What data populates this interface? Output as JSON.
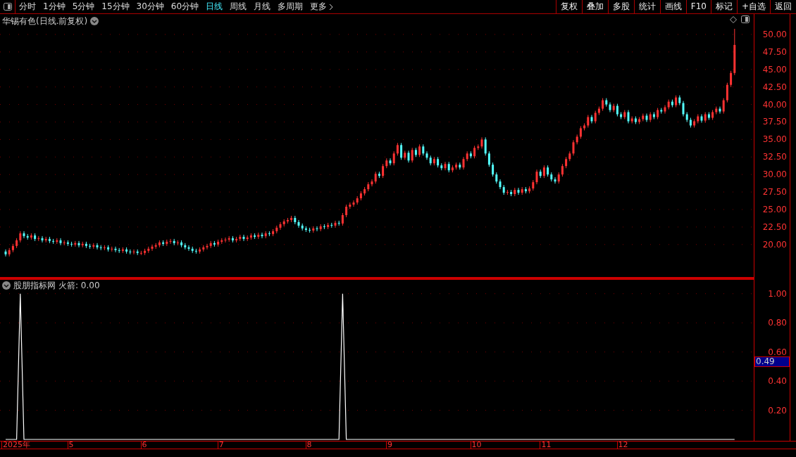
{
  "toolbar": {
    "periods": [
      {
        "label": "分时",
        "selected": false
      },
      {
        "label": "1分钟",
        "selected": false
      },
      {
        "label": "5分钟",
        "selected": false
      },
      {
        "label": "15分钟",
        "selected": false
      },
      {
        "label": "30分钟",
        "selected": false
      },
      {
        "label": "60分钟",
        "selected": false
      },
      {
        "label": "日线",
        "selected": true
      },
      {
        "label": "周线",
        "selected": false
      },
      {
        "label": "月线",
        "selected": false
      },
      {
        "label": "多周期",
        "selected": false
      }
    ],
    "more": "更多",
    "actions": [
      "复权",
      "叠加",
      "多股",
      "统计",
      "画线",
      "F10",
      "标记",
      "+自选",
      "返回"
    ]
  },
  "main_chart": {
    "title": "华锡有色(日线.前复权)",
    "chart_data": {
      "type": "candlestick",
      "ylim": [
        15.16,
        52.91
      ],
      "grid": true,
      "yticks": [
        {
          "value": 50,
          "label": "50.00"
        },
        {
          "value": 47.5,
          "label": "47.50"
        },
        {
          "value": 45,
          "label": "45.00"
        },
        {
          "value": 42.5,
          "label": "42.50"
        },
        {
          "value": 40,
          "label": "40.00"
        },
        {
          "value": 37.5,
          "label": "37.50"
        },
        {
          "value": 35,
          "label": "35.00"
        },
        {
          "value": 32.5,
          "label": "32.50"
        },
        {
          "value": 30,
          "label": "30.00"
        },
        {
          "value": 27.5,
          "label": "27.50"
        },
        {
          "value": 25,
          "label": "25.00"
        },
        {
          "value": 22.5,
          "label": "22.50"
        },
        {
          "value": 20,
          "label": "20.00"
        }
      ],
      "ohlc": [
        [
          19.0,
          19.3,
          18.3,
          18.6
        ],
        [
          18.6,
          19.5,
          18.3,
          19.2
        ],
        [
          19.2,
          20.1,
          18.9,
          19.8
        ],
        [
          19.8,
          20.9,
          19.5,
          20.6
        ],
        [
          20.6,
          21.9,
          20.3,
          21.6
        ],
        [
          21.6,
          21.9,
          20.9,
          21.2
        ],
        [
          21.2,
          21.5,
          20.7,
          21.0
        ],
        [
          21.0,
          21.6,
          20.7,
          21.3
        ],
        [
          21.3,
          21.6,
          20.5,
          20.8
        ],
        [
          20.8,
          21.2,
          20.5,
          20.9
        ],
        [
          20.9,
          21.2,
          20.3,
          20.6
        ],
        [
          20.6,
          21.1,
          20.3,
          20.8
        ],
        [
          20.8,
          21.1,
          20.2,
          20.5
        ],
        [
          20.5,
          20.8,
          20.1,
          20.4
        ],
        [
          20.4,
          20.9,
          20.1,
          20.6
        ],
        [
          20.6,
          20.9,
          19.9,
          20.2
        ],
        [
          20.2,
          20.6,
          19.9,
          20.3
        ],
        [
          20.3,
          20.6,
          19.8,
          20.1
        ],
        [
          20.1,
          20.4,
          19.7,
          20.0
        ],
        [
          20.0,
          20.5,
          19.7,
          20.2
        ],
        [
          20.2,
          20.5,
          19.6,
          19.9
        ],
        [
          19.9,
          20.4,
          19.6,
          20.1
        ],
        [
          20.1,
          20.4,
          19.5,
          19.8
        ],
        [
          19.8,
          20.1,
          19.4,
          19.7
        ],
        [
          19.7,
          20.2,
          19.4,
          19.9
        ],
        [
          19.9,
          20.2,
          19.3,
          19.6
        ],
        [
          19.6,
          19.9,
          19.2,
          19.5
        ],
        [
          19.5,
          19.9,
          19.2,
          19.6
        ],
        [
          19.6,
          19.9,
          19.0,
          19.3
        ],
        [
          19.3,
          19.7,
          19.0,
          19.4
        ],
        [
          19.4,
          19.7,
          18.9,
          19.2
        ],
        [
          19.2,
          19.5,
          18.8,
          19.1
        ],
        [
          19.1,
          19.6,
          18.8,
          19.3
        ],
        [
          19.3,
          19.6,
          18.7,
          19.0
        ],
        [
          19.0,
          19.3,
          18.6,
          18.9
        ],
        [
          18.9,
          19.3,
          18.6,
          19.0
        ],
        [
          19.0,
          19.3,
          18.5,
          18.8
        ],
        [
          18.8,
          19.1,
          18.5,
          18.8
        ],
        [
          18.8,
          19.4,
          18.5,
          19.1
        ],
        [
          19.1,
          19.7,
          18.8,
          19.4
        ],
        [
          19.4,
          20.0,
          19.1,
          19.7
        ],
        [
          19.7,
          20.2,
          19.4,
          19.9
        ],
        [
          19.9,
          20.6,
          19.6,
          20.3
        ],
        [
          20.3,
          20.6,
          19.8,
          20.1
        ],
        [
          20.1,
          20.7,
          19.8,
          20.4
        ],
        [
          20.4,
          20.8,
          20.1,
          20.5
        ],
        [
          20.5,
          20.8,
          19.9,
          20.2
        ],
        [
          20.2,
          20.6,
          19.9,
          20.3
        ],
        [
          20.3,
          20.6,
          19.6,
          19.9
        ],
        [
          19.9,
          20.2,
          19.3,
          19.6
        ],
        [
          19.6,
          19.9,
          19.1,
          19.4
        ],
        [
          19.4,
          19.7,
          18.8,
          19.1
        ],
        [
          19.1,
          19.4,
          18.7,
          19.0
        ],
        [
          19.0,
          19.6,
          18.7,
          19.3
        ],
        [
          19.3,
          19.9,
          19.0,
          19.6
        ],
        [
          19.6,
          20.1,
          19.3,
          19.8
        ],
        [
          19.8,
          20.5,
          19.5,
          20.2
        ],
        [
          20.2,
          20.5,
          19.7,
          20.0
        ],
        [
          20.0,
          20.7,
          19.7,
          20.4
        ],
        [
          20.4,
          20.9,
          20.1,
          20.6
        ],
        [
          20.6,
          21.0,
          20.3,
          20.7
        ],
        [
          20.7,
          21.2,
          20.4,
          20.9
        ],
        [
          20.9,
          21.2,
          20.3,
          20.6
        ],
        [
          20.6,
          21.1,
          20.3,
          20.8
        ],
        [
          20.8,
          21.4,
          20.5,
          21.1
        ],
        [
          21.1,
          21.4,
          20.5,
          20.8
        ],
        [
          20.8,
          21.3,
          20.5,
          21.0
        ],
        [
          21.0,
          21.6,
          20.7,
          21.3
        ],
        [
          21.3,
          21.6,
          20.8,
          21.1
        ],
        [
          21.1,
          21.7,
          20.8,
          21.4
        ],
        [
          21.4,
          21.7,
          20.9,
          21.2
        ],
        [
          21.2,
          21.9,
          20.9,
          21.6
        ],
        [
          21.6,
          21.9,
          21.2,
          21.5
        ],
        [
          21.5,
          22.2,
          21.2,
          21.9
        ],
        [
          21.9,
          22.7,
          21.6,
          22.4
        ],
        [
          22.4,
          23.2,
          22.1,
          22.9
        ],
        [
          22.9,
          23.6,
          22.6,
          23.3
        ],
        [
          23.3,
          23.8,
          23.0,
          23.5
        ],
        [
          23.5,
          24.1,
          23.2,
          23.8
        ],
        [
          23.8,
          24.1,
          22.9,
          23.2
        ],
        [
          23.2,
          23.5,
          22.4,
          22.7
        ],
        [
          22.7,
          23.0,
          22.0,
          22.3
        ],
        [
          22.3,
          22.6,
          21.8,
          22.1
        ],
        [
          22.1,
          22.4,
          21.7,
          22.0
        ],
        [
          22.0,
          22.6,
          21.7,
          22.3
        ],
        [
          22.3,
          22.6,
          21.9,
          22.2
        ],
        [
          22.2,
          22.9,
          21.9,
          22.6
        ],
        [
          22.6,
          22.9,
          22.2,
          22.5
        ],
        [
          22.5,
          23.1,
          22.2,
          22.8
        ],
        [
          22.8,
          23.1,
          22.4,
          22.7
        ],
        [
          22.7,
          23.4,
          22.4,
          23.1
        ],
        [
          23.1,
          23.4,
          22.7,
          23.0
        ],
        [
          23.0,
          24.5,
          22.7,
          24.2
        ],
        [
          24.2,
          25.7,
          23.9,
          25.4
        ],
        [
          25.4,
          26.0,
          25.1,
          25.7
        ],
        [
          25.7,
          26.3,
          25.4,
          26.0
        ],
        [
          26.0,
          26.9,
          25.7,
          26.6
        ],
        [
          26.6,
          27.6,
          26.3,
          27.3
        ],
        [
          27.3,
          28.2,
          27.0,
          27.9
        ],
        [
          27.9,
          28.9,
          27.6,
          28.6
        ],
        [
          28.6,
          29.3,
          28.3,
          29.0
        ],
        [
          29.0,
          30.4,
          28.7,
          30.1
        ],
        [
          30.1,
          30.4,
          29.5,
          29.8
        ],
        [
          29.8,
          31.5,
          29.5,
          31.2
        ],
        [
          31.2,
          32.3,
          30.9,
          32.0
        ],
        [
          32.0,
          32.3,
          31.3,
          31.6
        ],
        [
          31.6,
          33.3,
          31.3,
          33.0
        ],
        [
          33.0,
          34.5,
          32.7,
          34.2
        ],
        [
          34.2,
          34.5,
          32.1,
          32.4
        ],
        [
          32.4,
          33.4,
          32.1,
          33.1
        ],
        [
          33.1,
          33.4,
          31.7,
          32.0
        ],
        [
          32.0,
          33.8,
          31.7,
          33.5
        ],
        [
          33.5,
          33.8,
          32.5,
          32.8
        ],
        [
          32.8,
          34.3,
          32.5,
          34.0
        ],
        [
          34.0,
          34.3,
          32.7,
          33.0
        ],
        [
          33.0,
          33.3,
          32.1,
          32.4
        ],
        [
          32.4,
          32.7,
          31.3,
          31.6
        ],
        [
          31.6,
          32.5,
          31.3,
          32.2
        ],
        [
          32.2,
          32.5,
          31.0,
          31.3
        ],
        [
          31.3,
          31.6,
          30.6,
          30.9
        ],
        [
          30.9,
          31.8,
          30.6,
          31.5
        ],
        [
          31.5,
          31.8,
          30.3,
          30.6
        ],
        [
          30.6,
          31.3,
          30.3,
          31.0
        ],
        [
          31.0,
          31.7,
          30.7,
          31.4
        ],
        [
          31.4,
          31.7,
          30.7,
          31.0
        ],
        [
          31.0,
          32.5,
          30.7,
          32.2
        ],
        [
          32.2,
          33.3,
          31.9,
          33.0
        ],
        [
          33.0,
          33.3,
          32.3,
          32.6
        ],
        [
          32.6,
          34.1,
          32.3,
          33.8
        ],
        [
          33.8,
          34.3,
          33.5,
          34.0
        ],
        [
          34.0,
          35.3,
          33.7,
          35.0
        ],
        [
          35.0,
          35.3,
          32.7,
          33.0
        ],
        [
          33.0,
          33.3,
          31.1,
          31.4
        ],
        [
          31.4,
          31.7,
          29.7,
          30.0
        ],
        [
          30.0,
          30.3,
          28.7,
          29.0
        ],
        [
          29.0,
          29.3,
          27.9,
          28.2
        ],
        [
          28.2,
          28.5,
          27.1,
          27.4
        ],
        [
          27.4,
          27.8,
          27.1,
          27.5
        ],
        [
          27.5,
          27.8,
          26.9,
          27.2
        ],
        [
          27.2,
          28.1,
          26.9,
          27.8
        ],
        [
          27.8,
          28.1,
          27.1,
          27.4
        ],
        [
          27.4,
          28.2,
          27.1,
          27.9
        ],
        [
          27.9,
          28.2,
          27.3,
          27.6
        ],
        [
          27.6,
          28.3,
          27.3,
          28.0
        ],
        [
          28.0,
          29.2,
          27.7,
          28.9
        ],
        [
          28.9,
          30.7,
          28.6,
          30.4
        ],
        [
          30.4,
          30.7,
          29.5,
          29.8
        ],
        [
          29.8,
          31.3,
          29.5,
          31.0
        ],
        [
          31.0,
          31.3,
          29.7,
          30.0
        ],
        [
          30.0,
          30.3,
          29.0,
          29.3
        ],
        [
          29.3,
          29.6,
          28.7,
          29.0
        ],
        [
          29.0,
          30.3,
          28.7,
          30.0
        ],
        [
          30.0,
          31.5,
          29.7,
          31.2
        ],
        [
          31.2,
          32.5,
          30.9,
          32.2
        ],
        [
          32.2,
          33.3,
          31.9,
          33.0
        ],
        [
          33.0,
          34.9,
          32.7,
          34.6
        ],
        [
          34.6,
          35.7,
          34.3,
          35.4
        ],
        [
          35.4,
          36.9,
          35.1,
          36.6
        ],
        [
          36.6,
          37.3,
          36.3,
          37.0
        ],
        [
          37.0,
          38.5,
          36.7,
          38.2
        ],
        [
          38.2,
          38.5,
          37.3,
          37.6
        ],
        [
          37.6,
          39.1,
          37.3,
          38.8
        ],
        [
          38.8,
          39.7,
          38.5,
          39.4
        ],
        [
          39.4,
          40.9,
          39.1,
          40.6
        ],
        [
          40.6,
          40.9,
          39.7,
          40.0
        ],
        [
          40.0,
          40.3,
          38.9,
          39.2
        ],
        [
          39.2,
          40.1,
          38.9,
          39.8
        ],
        [
          39.8,
          40.1,
          38.3,
          38.6
        ],
        [
          38.6,
          38.9,
          37.9,
          38.2
        ],
        [
          38.2,
          39.2,
          37.9,
          38.9
        ],
        [
          38.9,
          39.2,
          37.3,
          37.6
        ],
        [
          37.6,
          38.3,
          37.3,
          38.0
        ],
        [
          38.0,
          38.3,
          37.2,
          37.5
        ],
        [
          37.5,
          38.2,
          37.2,
          37.9
        ],
        [
          37.9,
          38.7,
          37.6,
          38.4
        ],
        [
          38.4,
          38.7,
          37.5,
          37.8
        ],
        [
          37.8,
          38.9,
          37.5,
          38.6
        ],
        [
          38.6,
          38.9,
          37.9,
          38.2
        ],
        [
          38.2,
          39.5,
          37.9,
          39.2
        ],
        [
          39.2,
          39.5,
          38.7,
          39.0
        ],
        [
          39.0,
          39.9,
          38.7,
          39.6
        ],
        [
          39.6,
          40.7,
          39.3,
          40.4
        ],
        [
          40.4,
          40.7,
          39.6,
          39.9
        ],
        [
          39.9,
          41.3,
          39.6,
          41.0
        ],
        [
          41.0,
          41.3,
          39.9,
          40.2
        ],
        [
          40.2,
          40.5,
          38.3,
          38.6
        ],
        [
          38.6,
          38.9,
          37.5,
          37.8
        ],
        [
          37.8,
          38.1,
          36.7,
          37.0
        ],
        [
          37.0,
          37.9,
          36.7,
          37.6
        ],
        [
          37.6,
          38.6,
          37.3,
          38.3
        ],
        [
          38.3,
          38.6,
          37.4,
          37.7
        ],
        [
          37.7,
          38.9,
          37.4,
          38.6
        ],
        [
          38.6,
          38.9,
          37.8,
          38.1
        ],
        [
          38.1,
          39.2,
          37.8,
          38.9
        ],
        [
          38.9,
          39.7,
          38.6,
          39.4
        ],
        [
          39.4,
          39.7,
          38.7,
          39.0
        ],
        [
          39.0,
          40.9,
          38.7,
          40.6
        ],
        [
          40.6,
          43.1,
          40.3,
          42.8
        ],
        [
          42.8,
          44.8,
          42.5,
          44.5
        ],
        [
          44.5,
          50.8,
          44.2,
          48.5
        ]
      ]
    }
  },
  "indicator": {
    "name": "股朋指标网",
    "series_label": "火箭: 0.00",
    "cursor_value": "0.49",
    "chart_data": {
      "type": "line",
      "ylim": [
        0,
        1.1
      ],
      "grid": true,
      "yticks": [
        {
          "value": 1,
          "label": "1.00"
        },
        {
          "value": 0.8,
          "label": "0.80"
        },
        {
          "value": 0.6,
          "label": "0.60"
        },
        {
          "value": 0.4,
          "label": "0.40"
        },
        {
          "value": 0.2,
          "label": "0.20"
        }
      ],
      "series": [
        {
          "color": "#ffffff",
          "values": [
            0,
            0,
            0,
            0,
            1,
            0,
            0,
            0,
            0,
            0,
            0,
            0,
            0,
            0,
            0,
            0,
            0,
            0,
            0,
            0,
            0,
            0,
            0,
            0,
            0,
            0,
            0,
            0,
            0,
            0,
            0,
            0,
            0,
            0,
            0,
            0,
            0,
            0,
            0,
            0,
            0,
            0,
            0,
            0,
            0,
            0,
            0,
            0,
            0,
            0,
            0,
            0,
            0,
            0,
            0,
            0,
            0,
            0,
            0,
            0,
            0,
            0,
            0,
            0,
            0,
            0,
            0,
            0,
            0,
            0,
            0,
            0,
            0,
            0,
            0,
            0,
            0,
            0,
            0,
            0,
            0,
            0,
            0,
            0,
            0,
            0,
            0,
            0,
            0,
            0,
            0,
            0,
            1,
            0,
            0,
            0,
            0,
            0,
            0,
            0,
            0,
            0,
            0,
            0,
            0,
            0,
            0,
            0,
            0,
            0,
            0,
            0,
            0,
            0,
            0,
            0,
            0,
            0,
            0,
            0,
            0,
            0,
            0,
            0,
            0,
            0,
            0,
            0,
            0,
            0,
            0,
            0,
            0,
            0,
            0,
            0,
            0,
            0,
            0,
            0,
            0,
            0,
            0,
            0,
            0,
            0,
            0,
            0,
            0,
            0,
            0,
            0,
            0,
            0,
            0,
            0,
            0,
            0,
            0,
            0,
            0,
            0,
            0,
            0,
            0,
            0,
            0,
            0,
            0,
            0,
            0,
            0,
            0,
            0,
            0,
            0,
            0,
            0,
            0,
            0,
            0,
            0,
            0,
            0,
            0,
            0,
            0,
            0,
            0,
            0,
            0,
            0,
            0,
            0,
            0,
            0,
            0,
            0,
            0,
            0
          ]
        }
      ]
    }
  },
  "date_axis": [
    "2025年",
    "5",
    "6",
    "7",
    "8",
    "9",
    "10",
    "11",
    "12"
  ]
}
